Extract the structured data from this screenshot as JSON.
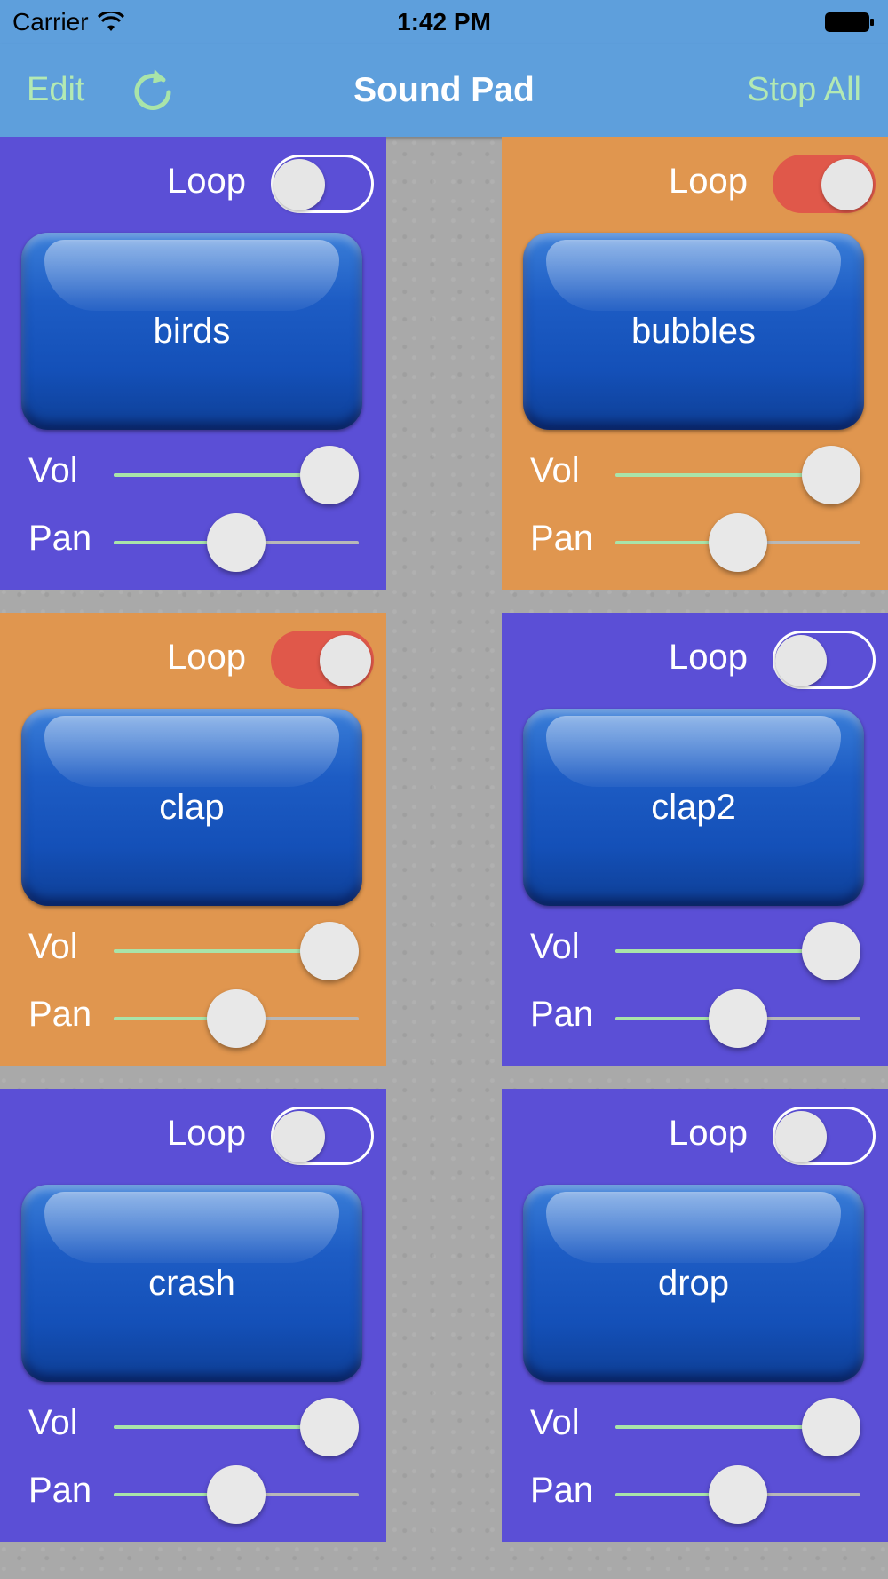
{
  "status_bar": {
    "carrier": "Carrier",
    "time": "1:42 PM"
  },
  "nav": {
    "edit_label": "Edit",
    "title": "Sound Pad",
    "stop_all_label": "Stop All"
  },
  "colors": {
    "purple": "#5b4fd6",
    "orange": "#e0964f",
    "nav_bg": "#5e9fdc",
    "nav_button": "#b3e9b3",
    "toggle_on": "#e0584a"
  },
  "pads": [
    {
      "name": "birds",
      "color": "purple",
      "loop_label": "Loop",
      "loop": false,
      "vol_label": "Vol",
      "vol": 0.9,
      "pan_label": "Pan",
      "pan": 0.5
    },
    {
      "name": "bubbles",
      "color": "orange",
      "loop_label": "Loop",
      "loop": true,
      "vol_label": "Vol",
      "vol": 0.9,
      "pan_label": "Pan",
      "pan": 0.5
    },
    {
      "name": "clap",
      "color": "orange",
      "loop_label": "Loop",
      "loop": true,
      "vol_label": "Vol",
      "vol": 0.9,
      "pan_label": "Pan",
      "pan": 0.5
    },
    {
      "name": "clap2",
      "color": "purple",
      "loop_label": "Loop",
      "loop": false,
      "vol_label": "Vol",
      "vol": 0.9,
      "pan_label": "Pan",
      "pan": 0.5
    },
    {
      "name": "crash",
      "color": "purple",
      "loop_label": "Loop",
      "loop": false,
      "vol_label": "Vol",
      "vol": 0.9,
      "pan_label": "Pan",
      "pan": 0.5
    },
    {
      "name": "drop",
      "color": "purple",
      "loop_label": "Loop",
      "loop": false,
      "vol_label": "Vol",
      "vol": 0.9,
      "pan_label": "Pan",
      "pan": 0.5
    }
  ]
}
